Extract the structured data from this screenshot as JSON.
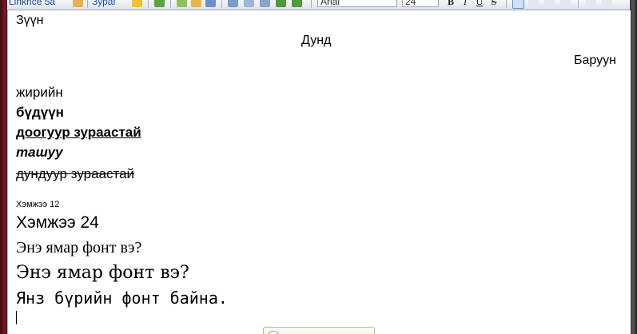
{
  "toolbar": {
    "link1_label": "Linkhce 5a",
    "link2_label": "Зураг",
    "font_name": "Arial",
    "font_size": "24",
    "bold_label": "B",
    "italic_label": "I",
    "underline_label": "U",
    "strike_label": "S"
  },
  "document": {
    "line_left": "Зүүн",
    "line_center": "Дунд",
    "line_right": "Баруун",
    "normal": "жирийн",
    "bold": "бүдүүн",
    "bold_underline": "доогуур зураастай",
    "bold_italic": "ташуу",
    "strikethrough": "дундуур зураастай",
    "size12": "Хэмжээ 12",
    "size24": "Хэмжээ 24",
    "font_question_1": "Энэ ямар фонт вэ?",
    "font_question_2": "Энэ ямар фонт вэ?",
    "mono_line": "Янз бүрийн фонт байна."
  },
  "colors": {
    "frame_accent": "#8a1020",
    "link_blue": "#1b4fa8"
  }
}
